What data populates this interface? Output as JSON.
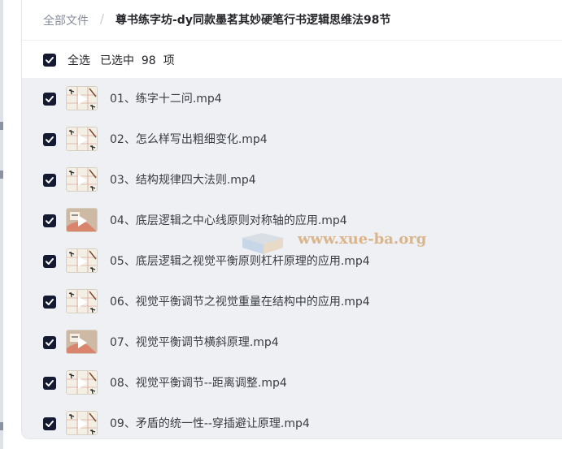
{
  "breadcrumb": {
    "root": "全部文件",
    "separator": "/",
    "current": "尊书练字坊-dy同款墨茗其妙硬笔行书逻辑思维法98节"
  },
  "selection": {
    "select_all_label": "全选",
    "selected_text": "已选中  98  项",
    "checked": true
  },
  "files": [
    {
      "name": "01、练字十二问.mp4",
      "thumb": "grid-pen"
    },
    {
      "name": "02、怎么样写出粗细变化.mp4",
      "thumb": "grid-pen"
    },
    {
      "name": "03、结构规律四大法则.mp4",
      "thumb": "grid-pen"
    },
    {
      "name": "04、底层逻辑之中心线原则对称轴的应用.mp4",
      "thumb": "hand-pen"
    },
    {
      "name": "05、底层逻辑之视觉平衡原则杠杆原理的应用.mp4",
      "thumb": "grid-pen"
    },
    {
      "name": "06、视觉平衡调节之视觉重量在结构中的应用.mp4",
      "thumb": "grid-pen"
    },
    {
      "name": "07、视觉平衡调节横斜原理.mp4",
      "thumb": "hand-pen"
    },
    {
      "name": "08、视觉平衡调节--距离调整.mp4",
      "thumb": "grid-pen"
    },
    {
      "name": "09、矛盾的统一性--穿插避让原理.mp4",
      "thumb": "grid-pen"
    }
  ],
  "watermark": {
    "text": "www.xue-ba.org"
  },
  "colors": {
    "checkbox": "#141a32",
    "list_background": "#eef0f3",
    "breadcrumb_text": "#878c9c",
    "title_text": "#25262b",
    "watermark": "#d6aa78"
  }
}
